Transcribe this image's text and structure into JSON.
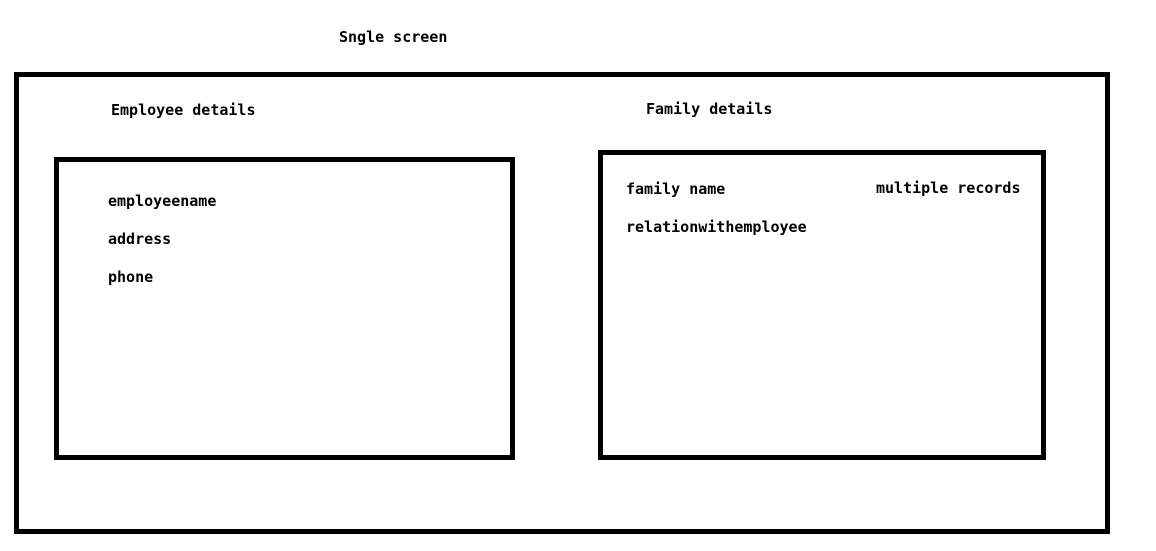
{
  "title": "Sngle screen",
  "employee_section": {
    "heading": "Employee details",
    "fields": [
      "employeename",
      "address",
      "phone"
    ]
  },
  "family_section": {
    "heading": "Family details",
    "fields": [
      "family name",
      "relationwithemployee"
    ],
    "note": "multiple records"
  },
  "colors": {
    "border": "#000000",
    "background": "#ffffff",
    "text": "#000000"
  }
}
